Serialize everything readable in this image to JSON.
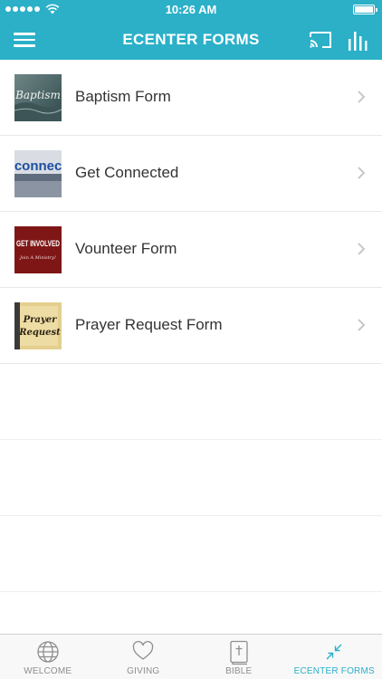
{
  "status_bar": {
    "time": "10:26 AM"
  },
  "nav_bar": {
    "title": "ECENTER FORMS"
  },
  "list": {
    "items": [
      {
        "label": "Baptism Form",
        "thumb_text": "Baptism"
      },
      {
        "label": "Get Connected",
        "thumb_text": "get connected"
      },
      {
        "label": "Vounteer Form",
        "thumb_text": "GET INVOLVED",
        "thumb_subtext": "Join A Ministry!"
      },
      {
        "label": "Prayer Request Form",
        "thumb_text": "Prayer",
        "thumb_text2": "Request"
      }
    ]
  },
  "tab_bar": {
    "tabs": [
      {
        "label": "WELCOME",
        "icon": "globe-icon"
      },
      {
        "label": "GIVING",
        "icon": "heart-icon"
      },
      {
        "label": "BIBLE",
        "icon": "bible-icon"
      },
      {
        "label": "ECENTER FORMS",
        "icon": "arrows-in-icon",
        "active": true
      }
    ]
  },
  "colors": {
    "accent": "#2bb0c8",
    "inactive_tab": "#8e8e8e"
  }
}
